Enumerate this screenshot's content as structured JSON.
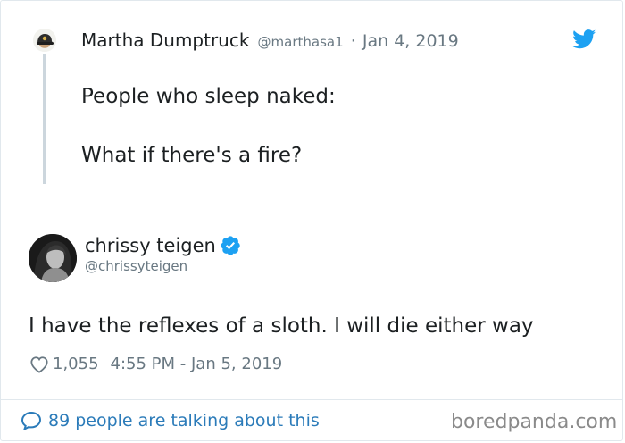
{
  "parent_tweet": {
    "author_name": "Martha Dumptruck",
    "handle": "@marthasa1",
    "separator": "·",
    "date": "Jan 4, 2019",
    "text_line_1": "People who sleep naked:",
    "text_line_2": "What if there's a fire?"
  },
  "reply_tweet": {
    "author_name": "chrissy teigen",
    "handle": "@chrissyteigen",
    "text": "I have the reflexes of a sloth. I will die either way",
    "likes": "1,055",
    "timestamp": "4:55 PM - Jan 5, 2019"
  },
  "footer": {
    "conversation_text": "89 people are talking about this",
    "watermark": "boredpanda.com"
  },
  "icons": {
    "brand": "twitter-bird-icon",
    "verified": "verified-badge-icon",
    "like": "heart-icon",
    "conversation": "speech-bubble-icon"
  },
  "colors": {
    "twitter_blue": "#1da1f2",
    "link_blue": "#2b7bb9",
    "muted_text": "#697882",
    "thread_line": "#ccd6dd"
  }
}
